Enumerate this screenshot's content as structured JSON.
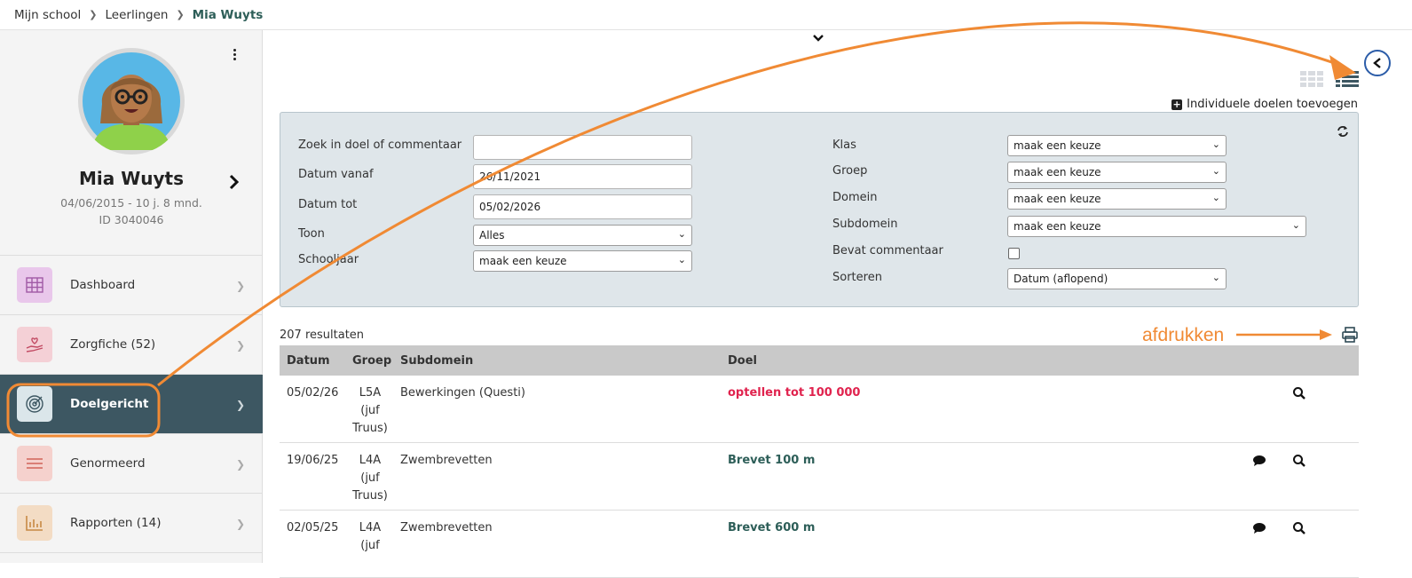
{
  "breadcrumb": {
    "items": [
      "Mijn school",
      "Leerlingen"
    ],
    "current": "Mia Wuyts"
  },
  "profile": {
    "name": "Mia Wuyts",
    "birth": "04/06/2015 - 10 j. 8 mnd.",
    "id": "ID 3040046"
  },
  "nav": [
    {
      "label": "Dashboard",
      "icon": "grid-icon",
      "bg": "#e9c7eb",
      "color": "#a05aa6"
    },
    {
      "label": "Zorgfiche  (52)",
      "icon": "care-hand-icon",
      "bg": "#f4d0d6",
      "color": "#c24a63"
    },
    {
      "label": "Doelgericht",
      "icon": "target-icon",
      "bg": "#dbe6ea",
      "color": "#3d5762",
      "active": true
    },
    {
      "label": "Genormeerd",
      "icon": "lines-icon",
      "bg": "#f5d1cd",
      "color": "#d2645a"
    },
    {
      "label": "Rapporten  (14)",
      "icon": "bar-chart-icon",
      "bg": "#f3dcc4",
      "color": "#c78a45"
    }
  ],
  "main": {
    "add_goals": "Individuele doelen toevoegen",
    "results": "207 resultaten",
    "print_annotation": "afdrukken"
  },
  "filters": {
    "search_label": "Zoek in doel of commentaar",
    "search_value": "",
    "from_label": "Datum vanaf",
    "from_value": "26/11/2021",
    "to_label": "Datum tot",
    "to_value": "05/02/2026",
    "show_label": "Toon",
    "show_value": "Alles",
    "year_label": "Schooljaar",
    "year_value": "maak een keuze",
    "class_label": "Klas",
    "class_value": "maak een keuze",
    "group_label": "Groep",
    "group_value": "maak een keuze",
    "domain_label": "Domein",
    "domain_value": "maak een keuze",
    "subdomain_label": "Subdomein",
    "subdomain_value": "maak een keuze",
    "comment_label": "Bevat commentaar",
    "sort_label": "Sorteren",
    "sort_value": "Datum (aflopend)"
  },
  "table": {
    "headers": [
      "Datum",
      "Groep",
      "Subdomein",
      "Doel"
    ],
    "rows": [
      {
        "date": "05/02/26",
        "group1": "L5A",
        "group2": "(juf",
        "group3": "Truus)",
        "subdomain": "Bewerkingen (Questi)",
        "goal": "optellen tot 100 000",
        "comment": false
      },
      {
        "date": "19/06/25",
        "group1": "L4A",
        "group2": "(juf",
        "group3": "Truus)",
        "subdomain": "Zwembrevetten",
        "goal": "Brevet 100 m",
        "comment": true
      },
      {
        "date": "02/05/25",
        "group1": "L4A",
        "group2": "(juf",
        "group3": "",
        "subdomain": "Zwembrevetten",
        "goal": "Brevet 600 m",
        "comment": true
      }
    ]
  },
  "colors": {
    "accent_orange": "#f08a34",
    "active_nav": "#3d5762",
    "goal_red": "#e0234e",
    "goal_green": "#2d5e58"
  }
}
